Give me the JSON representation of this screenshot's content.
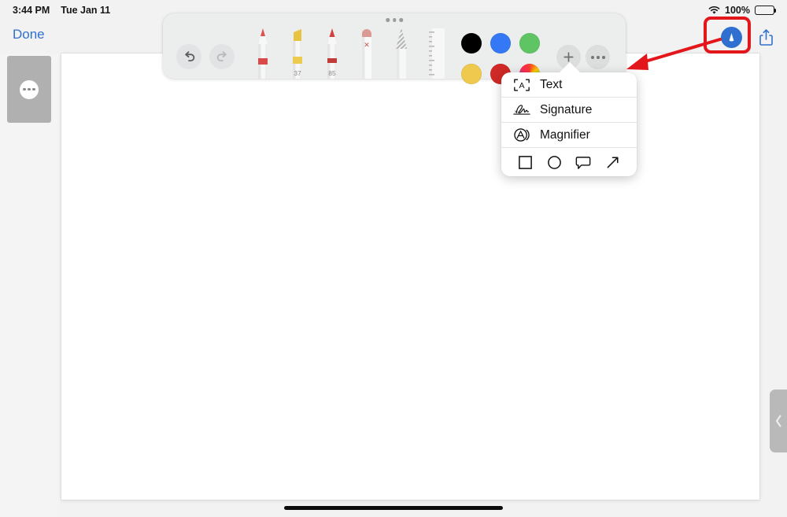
{
  "status_bar": {
    "time": "3:44 PM",
    "date": "Tue Jan 11",
    "wifi_icon": "wifi-icon",
    "battery_percent": "100%",
    "battery_icon": "battery-full-icon"
  },
  "nav_bar": {
    "done_label": "Done",
    "markup_icon": "markup-pen-circle-icon",
    "share_icon": "share-icon"
  },
  "annotation": {
    "highlight_color": "#e3171b",
    "arrow_icon": "red-arrow-pointing-left",
    "rect_icon": "red-highlight-rectangle"
  },
  "sidebar": {
    "thumbnail_menu_icon": "ellipsis-icon"
  },
  "canvas": {
    "right_tab_icon": "chevron-left-icon",
    "home_indicator_icon": "home-indicator"
  },
  "toolbar": {
    "grabber_icon": "drag-handle-dots-icon",
    "undo": {
      "label": "Undo",
      "icon": "undo-arrow-icon",
      "enabled": true
    },
    "redo": {
      "label": "Redo",
      "icon": "redo-arrow-icon",
      "enabled": false
    },
    "tools": [
      {
        "name": "pen",
        "label": "",
        "tip_color": "#d9534f",
        "band_color": "#d94a4a"
      },
      {
        "name": "highlighter",
        "label": "37",
        "tip_color": "#e8c33f",
        "band_color": "#eccb4e"
      },
      {
        "name": "thin-pen",
        "label": "85",
        "tip_color": "#d44141",
        "band_color": "#c23b3b"
      },
      {
        "name": "eraser",
        "label": "",
        "tip_color": "#dc9a96",
        "band_color": "#dc9a96"
      },
      {
        "name": "lasso-pencil",
        "label": "",
        "tip_color": "#c9c9c9",
        "band_color": "#c9c9c9"
      },
      {
        "name": "ruler",
        "label": "",
        "tip_color": "#e8e8e8",
        "band_color": "#e8e8e8"
      }
    ],
    "colors": [
      {
        "name": "black",
        "hex": "#000000"
      },
      {
        "name": "blue",
        "hex": "#3478f6"
      },
      {
        "name": "green",
        "hex": "#5fc463"
      },
      {
        "name": "yellow",
        "hex": "#eec councils"
      },
      {
        "name": "red",
        "hex": "#cf2a27"
      },
      {
        "name": "color-picker",
        "hex": "rainbow"
      }
    ],
    "add_button": {
      "label": "+",
      "icon": "plus-icon",
      "selected": true
    },
    "more_button": {
      "label": "",
      "icon": "ellipsis-icon"
    }
  },
  "popup_menu": {
    "items": [
      {
        "label": "Text",
        "icon": "text-box-icon"
      },
      {
        "label": "Signature",
        "icon": "signature-icon"
      },
      {
        "label": "Magnifier",
        "icon": "magnifier-icon"
      }
    ],
    "shapes": [
      {
        "name": "square",
        "icon": "square-icon"
      },
      {
        "name": "circle",
        "icon": "circle-icon"
      },
      {
        "name": "speech-bubble",
        "icon": "speech-bubble-icon"
      },
      {
        "name": "arrow",
        "icon": "arrow-icon"
      }
    ]
  }
}
